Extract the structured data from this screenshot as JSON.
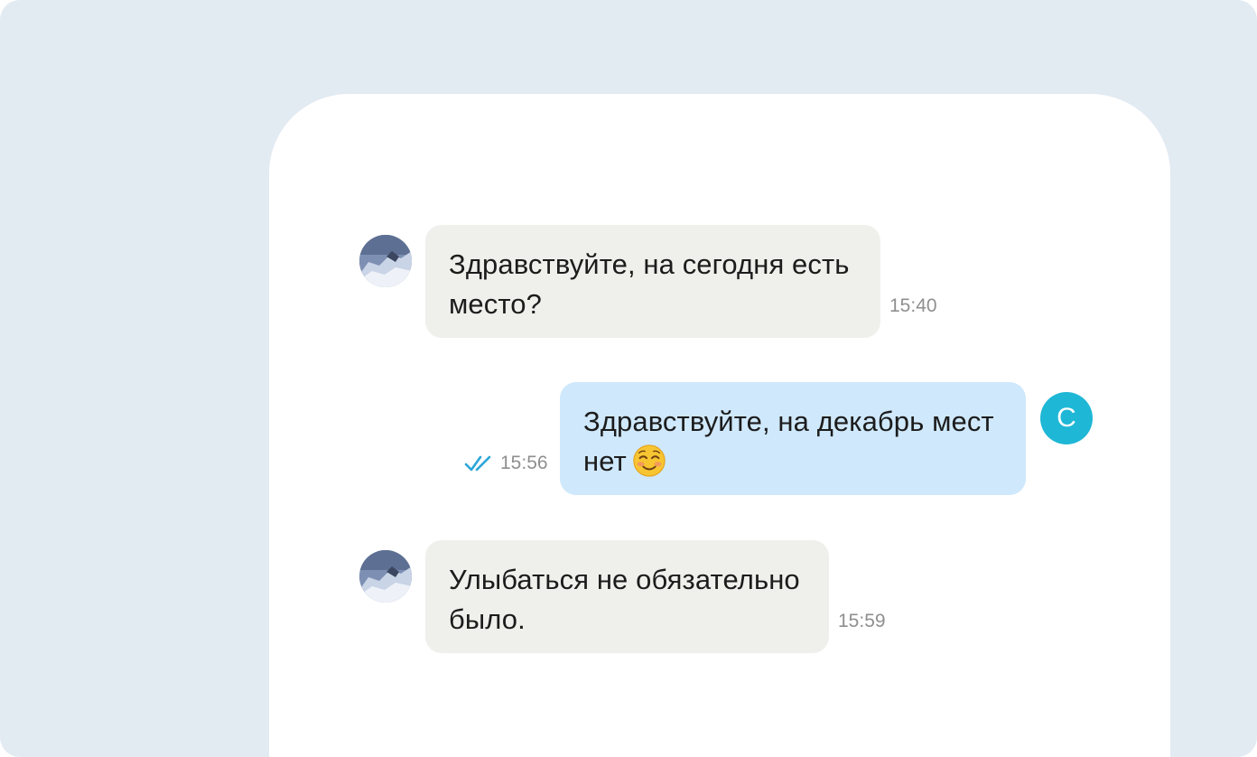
{
  "chat": {
    "messages": [
      {
        "direction": "incoming",
        "line1": "Здравствуйте, на сегодня есть",
        "line2": "место?",
        "time": "15:40"
      },
      {
        "direction": "outgoing",
        "line1": "Здравствуйте, на декабрь мест",
        "line2": "нет",
        "emoji": "smiling-face-with-blush-icon",
        "time": "15:56",
        "status": "read"
      },
      {
        "direction": "incoming",
        "line1": "Улыбаться не обязательно",
        "line2": "было.",
        "time": "15:59"
      }
    ],
    "own_avatar_letter": "C"
  },
  "colors": {
    "page_background": "#e2eaf2",
    "incoming_bubble": "#efefec",
    "outgoing_bubble": "#cfe8fb",
    "own_avatar": "#1fb7d6",
    "read_check": "#2aa6d9"
  }
}
